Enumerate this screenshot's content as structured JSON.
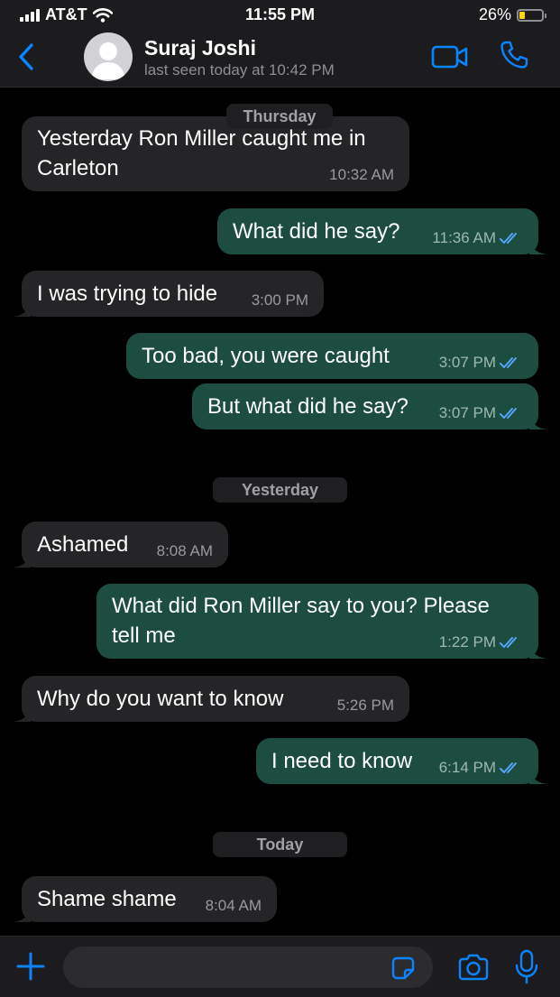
{
  "status_bar": {
    "carrier": "AT&T",
    "time": "11:55 PM",
    "battery_percent": "26%",
    "battery_level": 0.26,
    "signal_icon": "signal-bars-icon",
    "wifi_icon": "wifi-icon"
  },
  "header": {
    "contact_name": "Suraj Joshi",
    "last_seen": "last seen today at 10:42 PM",
    "back_icon": "chevron-left-icon",
    "video_icon": "video-call-icon",
    "call_icon": "phone-icon"
  },
  "colors": {
    "accent": "#0a84ff",
    "outgoing_bubble": "#1d4d40",
    "incoming_bubble": "#252527",
    "read_ticks": "#53a6f8",
    "battery": "#ffd60a"
  },
  "chat": {
    "day_labels": [
      "Thursday",
      "Yesterday",
      "Today"
    ],
    "messages": [
      {
        "dir": "in",
        "text": "Yesterday Ron Miller caught me in",
        "text2": "Carleton",
        "time": "10:32 AM"
      },
      {
        "dir": "out",
        "text": "What did he say?",
        "time": "11:36 AM",
        "read": true
      },
      {
        "dir": "in",
        "text": "I was trying to hide",
        "time": "3:00 PM"
      },
      {
        "dir": "out",
        "text": "Too bad, you were caught",
        "time": "3:07 PM",
        "read": true
      },
      {
        "dir": "out",
        "text": "But what did he say?",
        "time": "3:07 PM",
        "read": true
      },
      {
        "dir": "in",
        "text": "Ashamed",
        "time": "8:08 AM"
      },
      {
        "dir": "out",
        "text": "What did Ron Miller say to you? Please",
        "text2": "tell me",
        "time": "1:22 PM",
        "read": true
      },
      {
        "dir": "in",
        "text": "Why do you want to know",
        "time": "5:26 PM"
      },
      {
        "dir": "out",
        "text": "I need to know",
        "time": "6:14 PM",
        "read": true
      },
      {
        "dir": "in",
        "text": "Shame shame",
        "time": "8:04 AM"
      }
    ]
  },
  "input_bar": {
    "value": "",
    "placeholder": "",
    "plus_icon": "plus-icon",
    "sticker_icon": "sticker-icon",
    "camera_icon": "camera-icon",
    "mic_icon": "microphone-icon"
  }
}
